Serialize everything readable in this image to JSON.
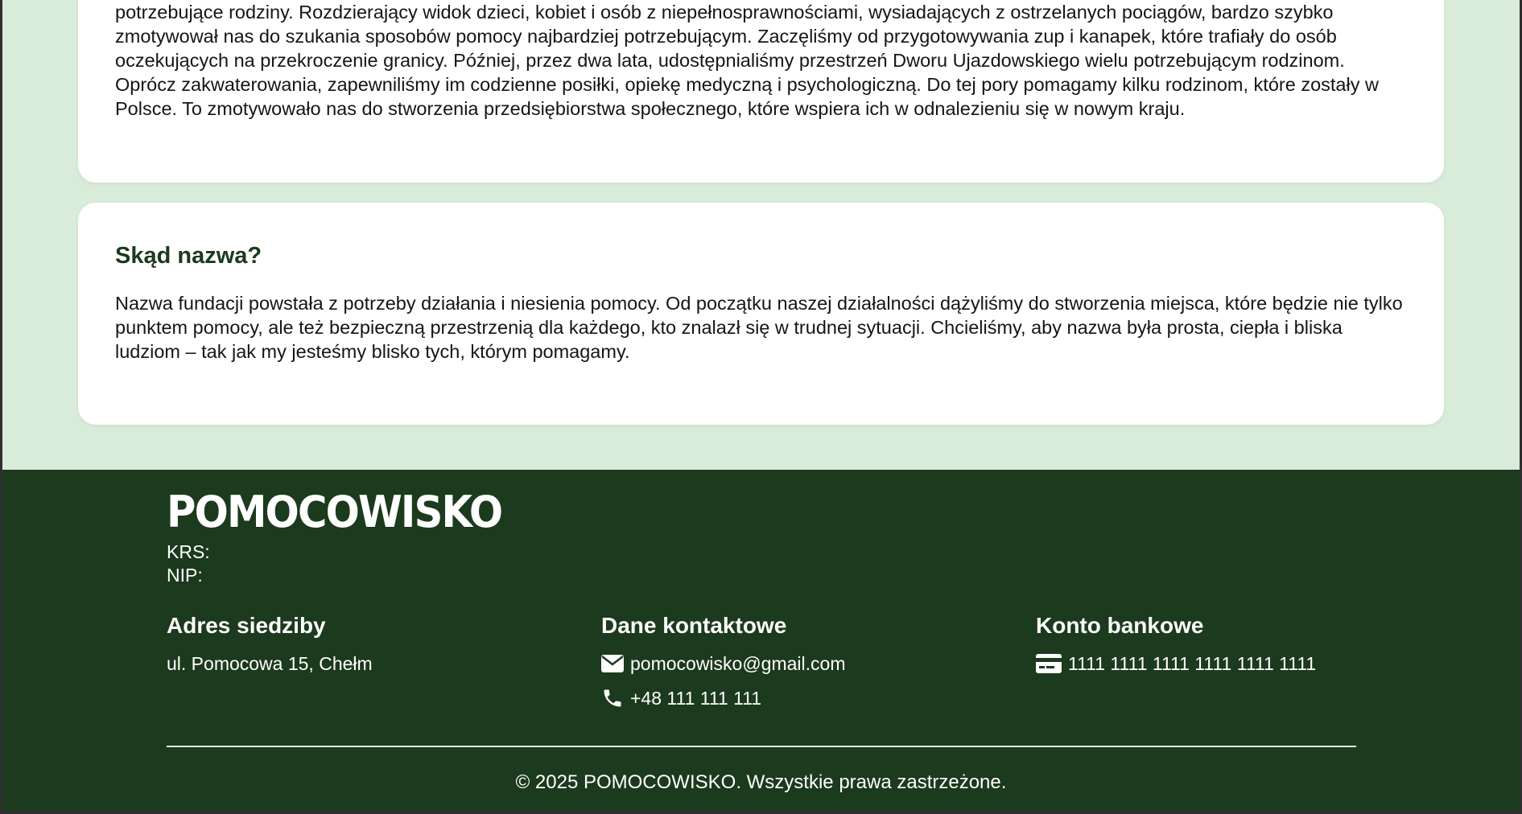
{
  "story": {
    "cut_line": "potrzebujące rodziny. Rozdzierający widok dzieci, kobiet i osób z niepełnosprawnościami, wysiadających z ostrzelanych pociągów, bardzo szybko",
    "paragraph": "potrzebujące rodziny. Rozdzierający widok dzieci, kobiet i osób z niepełnosprawnościami, wysiadających z ostrzelanych pociągów, bardzo szybko zmotywował nas do szukania sposobów pomocy najbardziej potrzebującym. Zaczęliśmy od przygotowywania zup i kanapek, które trafiały do osób oczekujących na przekroczenie granicy. Później, przez dwa lata, udostępnialiśmy przestrzeń Dworu Ujazdowskiego wielu potrzebującym rodzinom. Oprócz zakwaterowania, zapewniliśmy im codzienne posiłki, opiekę medyczną i psychologiczną. Do tej pory pomagamy kilku rodzinom, które zostały w Polsce. To zmotywowało nas do stworzenia przedsiębiorstwa społecznego, które wspiera ich w odnalezieniu się w nowym kraju."
  },
  "name_section": {
    "title": "Skąd nazwa?",
    "paragraph": "Nazwa fundacji powstała z potrzeby działania i niesienia pomocy. Od początku naszej działalności dążyliśmy do stworzenia miejsca, które będzie nie tylko punktem pomocy, ale też bezpieczną przestrzenią dla każdego, kto znalazł się w trudnej sytuacji. Chcieliśmy, aby nazwa była prosta, ciepła i bliska ludziom – tak jak my jesteśmy blisko tych, którym pomagamy."
  },
  "footer": {
    "logo": "POMOCOWISKO",
    "krs": "KRS:",
    "nip": "NIP:",
    "address": {
      "title": "Adres siedziby",
      "value": "ul. Pomocowa 15, Chełm"
    },
    "contact": {
      "title": "Dane kontaktowe",
      "email": "pomocowisko@gmail.com",
      "phone": "+48 111 111 111",
      "email_icon": "envelope-icon",
      "phone_icon": "phone-icon"
    },
    "bank": {
      "title": "Konto bankowe",
      "account": "1111 1111 1111 1111 1111 1111",
      "icon": "credit-card-icon"
    },
    "copyright": "© 2025 POMOCOWISKO. Wszystkie prawa zastrzeżone."
  },
  "colors": {
    "page_background": "#d9ecd9",
    "footer_background": "#1c3a1e",
    "heading_green": "#1b3a1d",
    "card_background": "#ffffff"
  }
}
